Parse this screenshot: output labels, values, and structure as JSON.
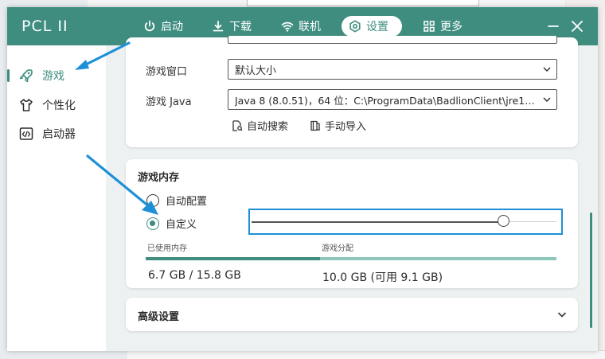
{
  "app": {
    "logo": "PCL II"
  },
  "nav": [
    {
      "id": "launch",
      "label": "启动",
      "icon": "power-icon"
    },
    {
      "id": "download",
      "label": "下载",
      "icon": "download-icon"
    },
    {
      "id": "online",
      "label": "联机",
      "icon": "wifi-icon"
    },
    {
      "id": "settings",
      "label": "设置",
      "icon": "gear-icon",
      "active": true
    },
    {
      "id": "more",
      "label": "更多",
      "icon": "grid-icon"
    }
  ],
  "sidebar": [
    {
      "label": "游戏",
      "icon": "rocket-icon",
      "active": true
    },
    {
      "label": "个性化",
      "icon": "shirt-icon"
    },
    {
      "label": "启动器",
      "icon": "code-icon"
    }
  ],
  "game_settings": {
    "window_label": "游戏窗口",
    "window_value": "默认大小",
    "java_label": "游戏 Java",
    "java_value": "Java 8 (8.0.51)，64 位：C:\\ProgramData\\BadlionClient\\jre1.8.0...",
    "auto_search": "自动搜索",
    "manual_import": "手动导入"
  },
  "memory": {
    "title": "游戏内存",
    "option_auto": "自动配置",
    "option_custom": "自定义",
    "selected": "custom",
    "slider_fraction": 0.83,
    "used_label": "已使用内存",
    "alloc_label": "游戏分配",
    "used_value": "6.7 GB / 15.8 GB",
    "alloc_value": "10.0 GB (可用 9.1 GB)",
    "used_fraction": 0.424,
    "alloc_fraction": 0.633
  },
  "advanced": {
    "title": "高级设置"
  },
  "colors": {
    "accent": "#3e8d7f",
    "accent_light": "#8fc6bc",
    "highlight": "#1e90d6"
  }
}
